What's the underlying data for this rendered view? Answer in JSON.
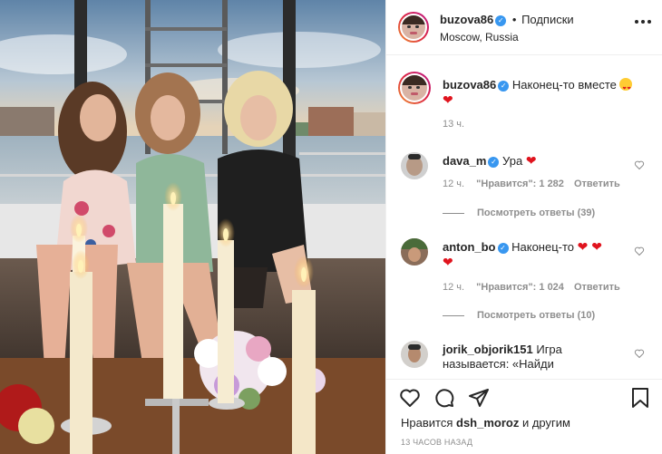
{
  "header": {
    "username": "buzova86",
    "verified_mark": "✓",
    "follow_dot": "•",
    "follow_label": "Подписки",
    "location": "Moscow, Russia",
    "more_icon": "more-horizontal-icon"
  },
  "caption": {
    "username": "buzova86",
    "text": "Наконец-то вместе",
    "emoji": "heart-eyes-emoji",
    "heart": "❤",
    "time": "13 ч."
  },
  "comments": [
    {
      "username": "dava_m",
      "text": "Ура",
      "hearts": "❤",
      "time": "12 ч.",
      "likes": "\"Нравится\": 1 282",
      "reply": "Ответить",
      "view_replies": "Посмотреть ответы (39)"
    },
    {
      "username": "anton_bo",
      "text": "Наконец-то",
      "hearts": "❤ ❤",
      "hearts2": "❤",
      "time": "12 ч.",
      "likes": "\"Нравится\": 1 024",
      "reply": "Ответить",
      "view_replies": "Посмотреть ответы (10)"
    },
    {
      "username": "jorik_objorik151",
      "text": "Игра",
      "text2": "называется: «Найди"
    }
  ],
  "actions": {
    "likes_prefix": "Нравится",
    "likes_user": "dsh_moroz",
    "likes_suffix": "и другим",
    "timestamp": "13 ЧАСОВ НАЗАД"
  },
  "colors": {
    "verified": "#3897f0",
    "heart": "#e0141e",
    "gray": "#8e8e8e"
  }
}
